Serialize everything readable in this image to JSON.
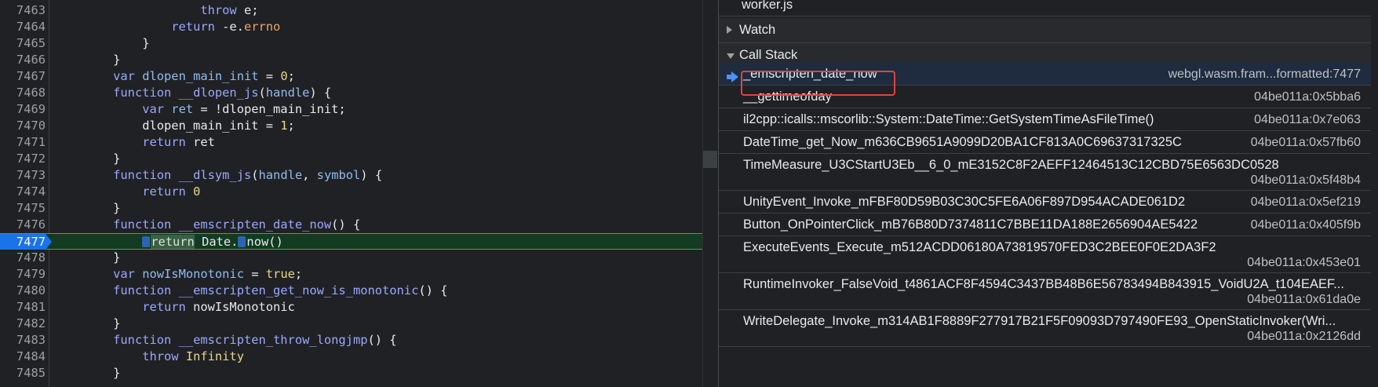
{
  "editor": {
    "lines": [
      {
        "num": "7463",
        "segments": [
          {
            "t": "                    "
          },
          {
            "t": "throw",
            "c": "kw"
          },
          {
            "t": " e;"
          }
        ]
      },
      {
        "num": "7464",
        "segments": [
          {
            "t": "                "
          },
          {
            "t": "return",
            "c": "kw"
          },
          {
            "t": " -e."
          },
          {
            "t": "errno",
            "c": "prop"
          }
        ]
      },
      {
        "num": "7465",
        "segments": [
          {
            "t": "            }"
          }
        ]
      },
      {
        "num": "7466",
        "segments": [
          {
            "t": "        }"
          }
        ]
      },
      {
        "num": "7467",
        "segments": [
          {
            "t": "        "
          },
          {
            "t": "var",
            "c": "kw"
          },
          {
            "t": " "
          },
          {
            "t": "dlopen_main_init",
            "c": "pm"
          },
          {
            "t": " = "
          },
          {
            "t": "0",
            "c": "nm"
          },
          {
            "t": ";"
          }
        ]
      },
      {
        "num": "7468",
        "segments": [
          {
            "t": "        "
          },
          {
            "t": "function",
            "c": "kw"
          },
          {
            "t": " "
          },
          {
            "t": "__dlopen_js",
            "c": "fn"
          },
          {
            "t": "("
          },
          {
            "t": "handle",
            "c": "pm"
          },
          {
            "t": ") {"
          }
        ]
      },
      {
        "num": "7469",
        "segments": [
          {
            "t": "            "
          },
          {
            "t": "var",
            "c": "kw"
          },
          {
            "t": " "
          },
          {
            "t": "ret",
            "c": "pm"
          },
          {
            "t": " = !dlopen_main_init;"
          }
        ]
      },
      {
        "num": "7470",
        "segments": [
          {
            "t": "            dlopen_main_init = "
          },
          {
            "t": "1",
            "c": "nm"
          },
          {
            "t": ";"
          }
        ]
      },
      {
        "num": "7471",
        "segments": [
          {
            "t": "            "
          },
          {
            "t": "return",
            "c": "kw"
          },
          {
            "t": " ret"
          }
        ]
      },
      {
        "num": "7472",
        "segments": [
          {
            "t": "        }"
          }
        ]
      },
      {
        "num": "7473",
        "segments": [
          {
            "t": "        "
          },
          {
            "t": "function",
            "c": "kw"
          },
          {
            "t": " "
          },
          {
            "t": "__dlsym_js",
            "c": "fn"
          },
          {
            "t": "("
          },
          {
            "t": "handle",
            "c": "pm"
          },
          {
            "t": ", "
          },
          {
            "t": "symbol",
            "c": "pm"
          },
          {
            "t": ") {"
          }
        ]
      },
      {
        "num": "7474",
        "segments": [
          {
            "t": "            "
          },
          {
            "t": "return",
            "c": "kw"
          },
          {
            "t": " "
          },
          {
            "t": "0",
            "c": "nm"
          }
        ]
      },
      {
        "num": "7475",
        "segments": [
          {
            "t": "        }"
          }
        ]
      },
      {
        "num": "7476",
        "segments": [
          {
            "t": "        "
          },
          {
            "t": "function",
            "c": "kw"
          },
          {
            "t": " "
          },
          {
            "t": "__emscripten_date_now",
            "c": "fn"
          },
          {
            "t": "() {"
          }
        ]
      },
      {
        "num": "7477",
        "current": true,
        "segments": [
          {
            "t": "            "
          },
          {
            "t": "M",
            "c": "marker"
          },
          {
            "t": "return",
            "c": "hl"
          },
          {
            "t": " Date."
          },
          {
            "t": "M",
            "c": "marker"
          },
          {
            "t": "now()"
          }
        ]
      },
      {
        "num": "7478",
        "segments": [
          {
            "t": "        }"
          }
        ]
      },
      {
        "num": "7479",
        "segments": [
          {
            "t": "        "
          },
          {
            "t": "var",
            "c": "kw"
          },
          {
            "t": " "
          },
          {
            "t": "nowIsMonotonic",
            "c": "pm"
          },
          {
            "t": " = "
          },
          {
            "t": "true",
            "c": "nm"
          },
          {
            "t": ";"
          }
        ]
      },
      {
        "num": "7480",
        "segments": [
          {
            "t": "        "
          },
          {
            "t": "function",
            "c": "kw"
          },
          {
            "t": " "
          },
          {
            "t": "__emscripten_get_now_is_monotonic",
            "c": "fn"
          },
          {
            "t": "() {"
          }
        ]
      },
      {
        "num": "7481",
        "segments": [
          {
            "t": "            "
          },
          {
            "t": "return",
            "c": "kw"
          },
          {
            "t": " nowIsMonotonic"
          }
        ]
      },
      {
        "num": "7482",
        "segments": [
          {
            "t": "        }"
          }
        ]
      },
      {
        "num": "7483",
        "segments": [
          {
            "t": "        "
          },
          {
            "t": "function",
            "c": "kw"
          },
          {
            "t": " "
          },
          {
            "t": "__emscripten_throw_longjmp",
            "c": "fn"
          },
          {
            "t": "() {"
          }
        ]
      },
      {
        "num": "7484",
        "segments": [
          {
            "t": "            "
          },
          {
            "t": "throw",
            "c": "kw"
          },
          {
            "t": " "
          },
          {
            "t": "Infinity",
            "c": "nm"
          }
        ]
      },
      {
        "num": "7485",
        "segments": [
          {
            "t": "        }"
          }
        ]
      }
    ]
  },
  "sidebar": {
    "source_file": "worker.js",
    "watch_label": "Watch",
    "callstack_label": "Call Stack",
    "frames": [
      {
        "name": "_emscripten_date_now",
        "loc": "webgl.wasm.fram...formatted:7477",
        "active": true
      },
      {
        "name": "__gettimeofday",
        "loc": "04be011a:0x5bba6"
      },
      {
        "name": "il2cpp::icalls::mscorlib::System::DateTime::GetSystemTimeAsFileTime()",
        "loc": "04be011a:0x7e063"
      },
      {
        "name": "DateTime_get_Now_m636CB9651A9099D20BA1CF813A0C69637317325C",
        "loc": "04be011a:0x57fb60"
      },
      {
        "name": "TimeMeasure_U3CStartU3Eb__6_0_mE3152C8F2AEFF12464513C12CBD75E6563DC0528",
        "loc": "04be011a:0x5f48b4",
        "wrap": true
      },
      {
        "name": "UnityEvent_Invoke_mFBF80D59B03C30C5FE6A06F897D954ACADE061D2",
        "loc": "04be011a:0x5ef219"
      },
      {
        "name": "Button_OnPointerClick_mB76B80D7374811C7BBE11DA188E2656904AE5422",
        "loc": "04be011a:0x405f9b"
      },
      {
        "name": "ExecuteEvents_Execute_m512ACDD06180A73819570FED3C2BEE0F0E2DA3F2",
        "loc": "04be011a:0x453e01",
        "wrap": true
      },
      {
        "name": "RuntimeInvoker_FalseVoid_t4861ACF8F4594C3437BB48B6E56783494B843915_VoidU2A_t104EAEF...",
        "loc": "04be011a:0x61da0e",
        "wrap": true
      },
      {
        "name": "WriteDelegate_Invoke_m314AB1F8889F277917B21F5F09093D797490FE93_OpenStaticInvoker(Wri...",
        "loc": "04be011a:0x2126dd",
        "wrap": true
      }
    ]
  },
  "colors": {
    "annotation": "#e0443e",
    "current_line": "#123b22",
    "gutter_active": "#1a73e8"
  }
}
